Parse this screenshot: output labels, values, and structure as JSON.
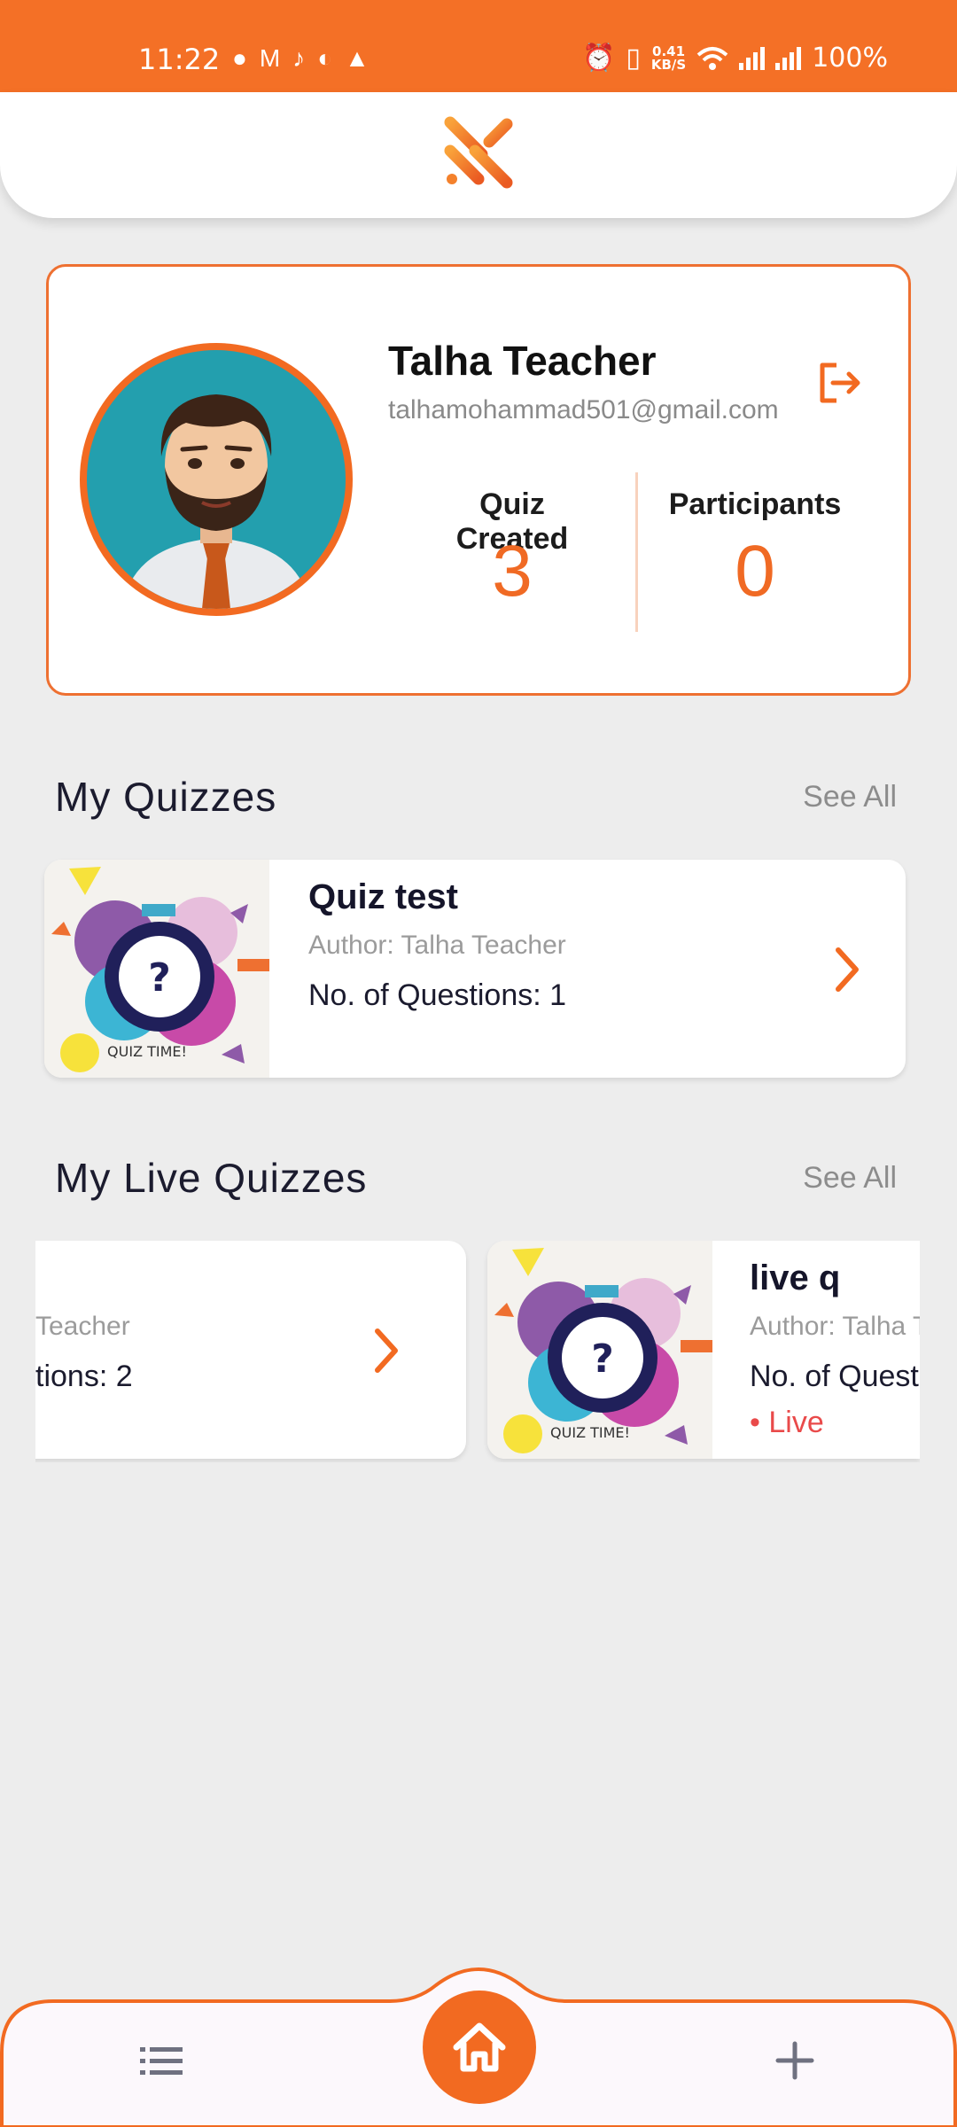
{
  "status_bar": {
    "time": "11:22",
    "speed_value": "0.41",
    "speed_unit": "KB/S",
    "battery": "100%"
  },
  "profile": {
    "name": "Talha Teacher",
    "email": "talhamohammad501@gmail.com",
    "stats": [
      {
        "label": "Quiz Created",
        "value": "3"
      },
      {
        "label": "Participants",
        "value": "0"
      }
    ]
  },
  "my_quizzes": {
    "title": "My Quizzes",
    "see_all": "See All",
    "items": [
      {
        "title": "Quiz test",
        "author": "Author: Talha Teacher",
        "questions": "No. of Questions: 1",
        "thumb_text": "QUIZ TIME!"
      }
    ]
  },
  "live_quizzes": {
    "title": "My Live Quizzes",
    "see_all": "See All",
    "items": [
      {
        "author_partial": "Teacher",
        "questions_partial": "tions: 2"
      },
      {
        "title": "live q",
        "author": "Author: Talha T",
        "questions": "No. of Quest",
        "status": "• Live",
        "thumb_text": "QUIZ TIME!"
      }
    ]
  },
  "colors": {
    "accent": "#f26a21",
    "background": "#ededed",
    "live": "#e94a4a"
  },
  "icons": {
    "logo": "brand-logo-icon",
    "logout": "logout-icon",
    "chevron": "chevron-right-icon",
    "home": "home-icon",
    "list": "list-icon",
    "add": "plus-icon"
  }
}
